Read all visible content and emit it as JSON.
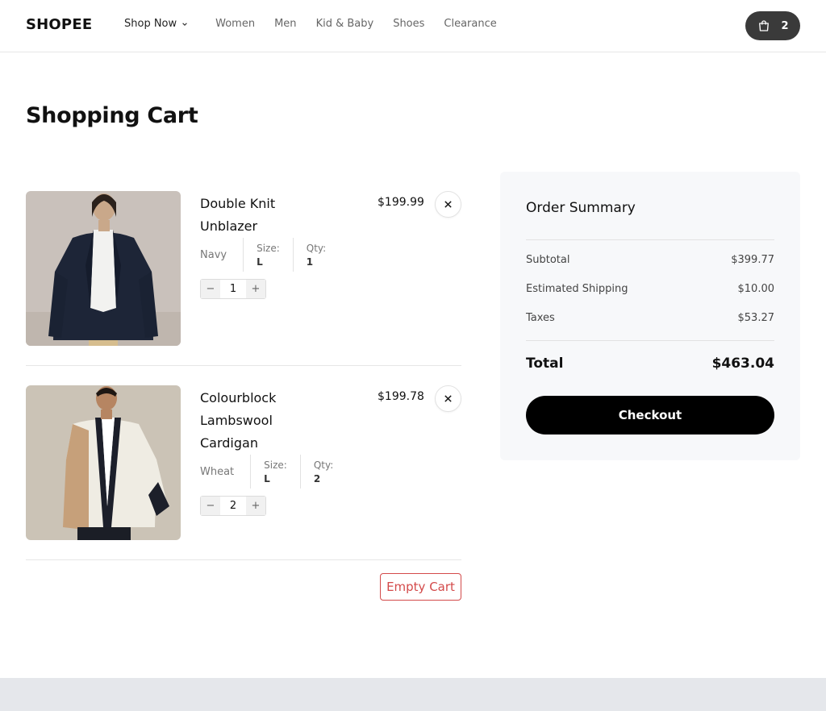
{
  "brand": {
    "logo": "SHOPEE"
  },
  "nav": {
    "shop_now": "Shop Now",
    "items": [
      "Women",
      "Men",
      "Kid & Baby",
      "Shoes",
      "Clearance"
    ]
  },
  "cart_badge": {
    "count": "2",
    "icon": "shopping-bag-icon"
  },
  "page": {
    "title": "Shopping Cart"
  },
  "cart_items": [
    {
      "name": "Double Knit Unblazer",
      "price": "$199.99",
      "color": "Navy",
      "size_label": "Size:",
      "size": "L",
      "qty_label": "Qty:",
      "qty": "1",
      "stepper_value": "1",
      "minus": "−",
      "plus": "+",
      "remove_icon": "close-icon"
    },
    {
      "name": "Colourblock Lambswool Cardigan",
      "price": "$199.78",
      "color": "Wheat",
      "size_label": "Size:",
      "size": "L",
      "qty_label": "Qty:",
      "qty": "2",
      "stepper_value": "2",
      "minus": "−",
      "plus": "+",
      "remove_icon": "close-icon"
    }
  ],
  "empty_cart": "Empty Cart",
  "summary": {
    "title": "Order Summary",
    "subtotal_label": "Subtotal",
    "subtotal": "$399.77",
    "shipping_label": "Estimated Shipping",
    "shipping": "$10.00",
    "taxes_label": "Taxes",
    "taxes": "$53.27",
    "total_label": "Total",
    "total": "$463.04",
    "checkout": "Checkout"
  },
  "colors": {
    "accent_danger": "#d34a4a",
    "checkout_bg": "#000000",
    "cart_badge_bg": "#3a3a3a",
    "summary_bg": "#f7f8fa",
    "footer_bg": "#e5e7eb"
  }
}
